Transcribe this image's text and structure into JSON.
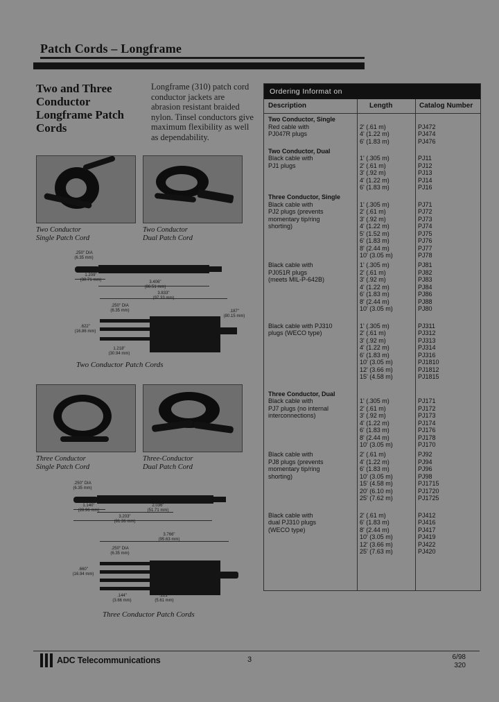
{
  "header": {
    "title": "Patch Cords – Longframe"
  },
  "intro": {
    "headline": "Two and Three Conductor Longframe Patch Cords",
    "body": "Longframe (310) patch cord conductor jackets are abrasion resistant braided nylon. Tinsel conductors give maximum flexibility as well as dependability."
  },
  "photos": [
    {
      "name": "two-conductor-single",
      "caption": "Two Conductor\nSingle Patch Cord"
    },
    {
      "name": "two-conductor-dual",
      "caption": "Two Conductor\nDual Patch Cord"
    },
    {
      "name": "three-conductor-single",
      "caption": "Three Conductor\nSingle Patch Cord"
    },
    {
      "name": "three-conductor-dual",
      "caption": "Three-Conductor\nDual Patch Cord"
    }
  ],
  "drawings": {
    "two_caption": "Two Conductor Patch Cords",
    "three_caption": "Three Conductor Patch Cords",
    "two_dims": {
      "d1": ".250\" DIA\n(6.35 mm)",
      "d2": "1.209\"\n(30.71 mm)",
      "d3": "3.406\"\n(86.51 mm)",
      "d4": "3.833\"\n(97.33 mm)",
      "d5": ".250\" DIA\n(6.35 mm)",
      "d6": ".187\"\n(80.15 mm)",
      "d7": ".622\"\n(16.86 mm)",
      "d8": "1.218\"\n(30.94 mm)"
    },
    "three_dims": {
      "d1": ".250\" DIA\n(6.35 mm)",
      "d2": "1.140\"\n(28.96 mm)",
      "d3": "2.036\"\n(51.71 mm)",
      "d4": "3.203\"\n(81.36 mm)",
      "d5": "3.766\"\n(95.63 mm)",
      "d6": ".250\" DIA\n(6.35 mm)",
      "d7": ".660\"\n(16.94 mm)",
      "d8": ".144\"\n(3.66 mm)",
      "d9": ".221\"\n(5.61 mm)"
    }
  },
  "table": {
    "title": "Ordering Informat on",
    "columns": [
      "Description",
      "Length",
      "Catalog Number"
    ],
    "groups": [
      {
        "description_bold": "Two Conductor, Single",
        "description_rest": "Red cable with\nPJ047R plugs",
        "lengths": [
          "2' (.61 m)",
          "4' (1.22 m)",
          "6' (1.83 m)"
        ],
        "catalogs": [
          "PJ472",
          "PJ474",
          "PJ476"
        ]
      },
      {
        "description_bold": "Two Conductor, Dual",
        "description_rest": "Black cable with\nPJ1 plugs",
        "lengths": [
          "1' (.305 m)",
          "2' (.61 m)",
          "3' (.92 m)",
          "4' (1.22 m)",
          "6' (1.83 m)"
        ],
        "catalogs": [
          "PJ11",
          "PJ12",
          "PJ13",
          "PJ14",
          "PJ16"
        ]
      },
      {
        "description_bold": "Three Conductor, Single",
        "description_rest": "Black cable with\nPJ2 plugs (prevents\nmomentary tip/ring\nshorting)",
        "lengths": [
          "1' (.305 m)",
          "2' (.61 m)",
          "3' (.92 m)",
          "4' (1.22 m)",
          "5' (1.52 m)",
          "6' (1.83 m)",
          "8' (2.44 m)",
          "10' (3.05 m)"
        ],
        "catalogs": [
          "PJ71",
          "PJ72",
          "PJ73",
          "PJ74",
          "PJ75",
          "PJ76",
          "PJ77",
          "PJ78"
        ]
      },
      {
        "description_bold": "",
        "description_rest": "Black cable with\nPJ051R plugs\n(meets MIL-P-642B)",
        "lengths": [
          "1' (.305 m)",
          "2' (.61 m)",
          "3' (.92 m)",
          "4' (1.22 m)",
          "6' (1.83 m)",
          "8' (2.44 m)",
          "10' (3.05 m)"
        ],
        "catalogs": [
          "PJ81",
          "PJ82",
          "PJ83",
          "PJ84",
          "PJ86",
          "PJ88",
          "PJ80"
        ]
      },
      {
        "description_bold": "",
        "description_rest": "Black cable with PJ310\nplugs (WECO type)",
        "lengths": [
          "1' (.305 m)",
          "2' (.61 m)",
          "3' (.92 m)",
          "4' (1.22 m)",
          "6' (1.83 m)",
          "10' (3.05 m)",
          "12' (3.66 m)",
          "15' (4.58 m)"
        ],
        "catalogs": [
          "PJ311",
          "PJ312",
          "PJ313",
          "PJ314",
          "PJ316",
          "PJ1810",
          "PJ1812",
          "PJ1815"
        ]
      },
      {
        "description_bold": "Three Conductor, Dual",
        "description_rest": "Black cable with\nPJ7 plugs (no internal\ninterconnections)",
        "lengths": [
          "1' (.305 m)",
          "2' (.61 m)",
          "3' (.92 m)",
          "4' (1.22 m)",
          "6' (1.83 m)",
          "8' (2.44 m)",
          "10' (3.05 m)"
        ],
        "catalogs": [
          "PJ171",
          "PJ172",
          "PJ173",
          "PJ174",
          "PJ176",
          "PJ178",
          "PJ170"
        ]
      },
      {
        "description_bold": "",
        "description_rest": "Black cable with\nPJ8 plugs (prevents\nmomentary tip/ring\nshorting)",
        "lengths": [
          "2' (.61 m)",
          "4' (1.22 m)",
          "6' (1.83 m)",
          "10' (3.05 m)",
          "15' (4.58 m)",
          "20' (6.10 m)",
          "25' (7.62 m)"
        ],
        "catalogs": [
          "PJ92",
          "PJ94",
          "PJ96",
          "PJ98",
          "PJ1715",
          "PJ1720",
          "PJ1725"
        ]
      },
      {
        "description_bold": "",
        "description_rest": "Black cable with\ndual PJ310 plugs\n(WECO type)",
        "lengths": [
          "2' (.61 m)",
          "6' (1.83 m)",
          "8' (2.44 m)",
          "10' (3.05 m)",
          "12' (3.66 m)",
          "25' (7.63 m)"
        ],
        "catalogs": [
          "PJ412",
          "PJ416",
          "PJ417",
          "PJ419",
          "PJ422",
          "PJ420"
        ]
      }
    ]
  },
  "footer": {
    "logo_text": "ADC Telecommunications",
    "page_number": "3",
    "date": "6/98",
    "doc_number": "320"
  }
}
